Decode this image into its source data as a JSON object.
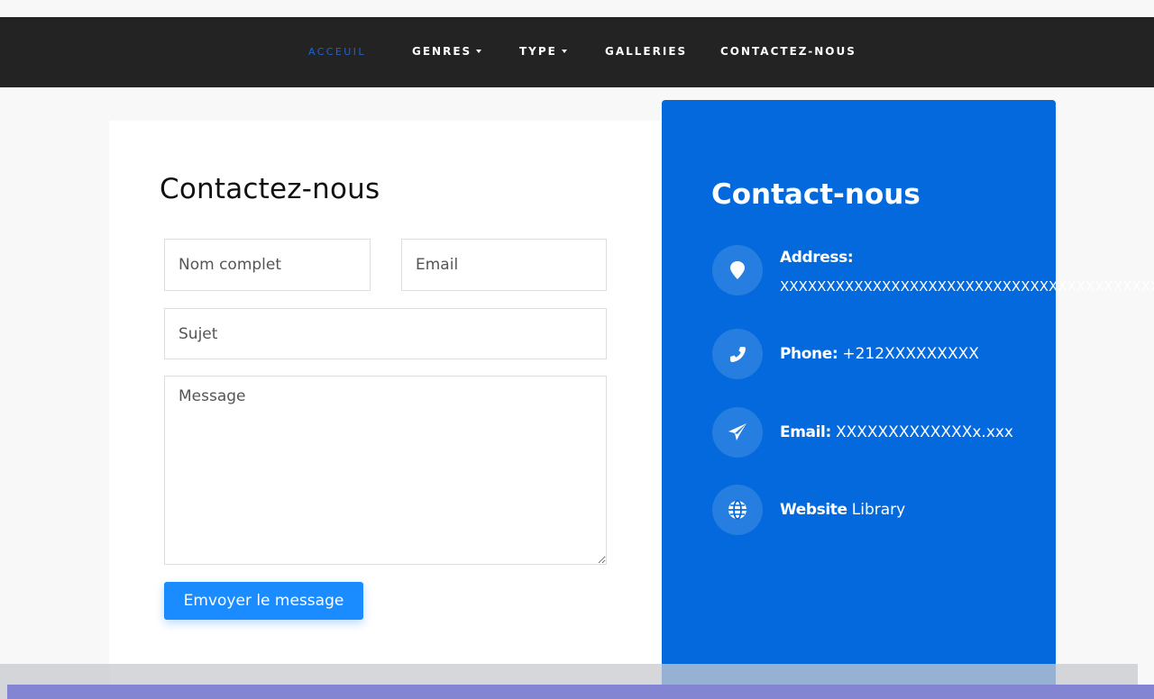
{
  "nav": {
    "items": [
      {
        "label": "ACCEUIL",
        "active": true
      },
      {
        "label": "GENRES",
        "dropdown": true
      },
      {
        "label": "TYPE",
        "dropdown": true
      },
      {
        "label": "GALLERIES"
      },
      {
        "label": "CONTACTEZ-NOUS"
      }
    ],
    "active_color": "#1d63d6"
  },
  "form": {
    "title": "Contactez-nous",
    "name_placeholder": "Nom complet",
    "email_placeholder": "Email",
    "subject_placeholder": "Sujet",
    "message_placeholder": "Message",
    "submit_label": "Emvoyer le message",
    "submit_color": "#1a8cff"
  },
  "contact": {
    "title": "Contact-nous",
    "panel_color": "#0369dc",
    "address": {
      "label": "Address:",
      "value": "XXXXXXXXXXXXXXXXXXXXXXXXXXXXXXXXXXXXXXXXX",
      "icon": "map-marker-icon"
    },
    "phone": {
      "label": "Phone:",
      "value": "+212XXXXXXXXX",
      "icon": "phone-icon"
    },
    "email": {
      "label": "Email:",
      "value": "XXXXXXXXXXXXXx.xxx",
      "icon": "paper-plane-icon"
    },
    "website": {
      "label": "Website",
      "value": "Library",
      "icon": "globe-icon"
    }
  }
}
